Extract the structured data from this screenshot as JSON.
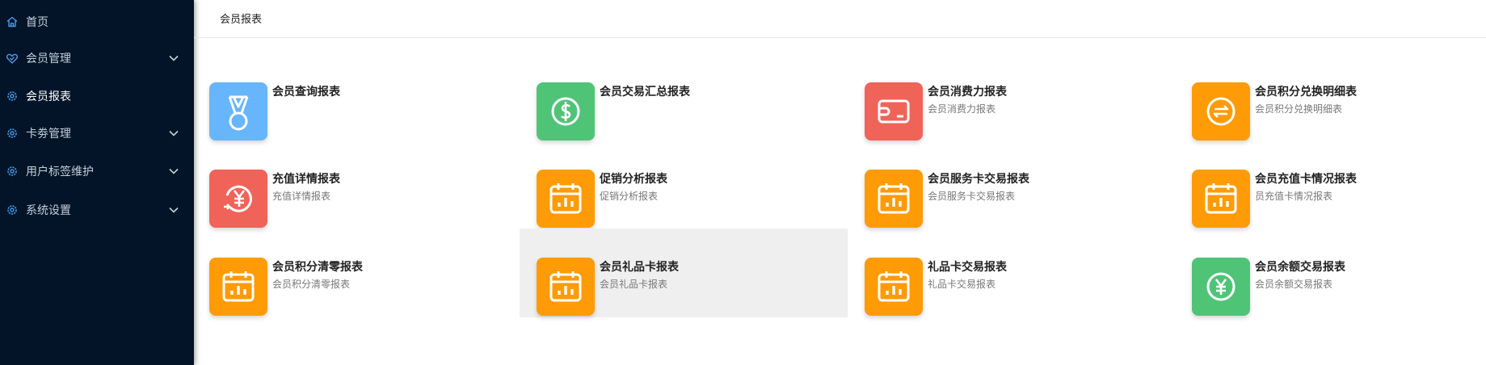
{
  "sidebar": {
    "items": [
      {
        "label": "首页",
        "icon": "home-icon",
        "expandable": false,
        "active": false
      },
      {
        "label": "会员管理",
        "icon": "heart-shield-icon",
        "expandable": true,
        "active": false
      },
      {
        "label": "会员报表",
        "icon": "gear-icon",
        "expandable": false,
        "active": true
      },
      {
        "label": "卡劵管理",
        "icon": "gear-icon",
        "expandable": true,
        "active": false
      },
      {
        "label": "用户标签维护",
        "icon": "gear-icon",
        "expandable": true,
        "active": false
      },
      {
        "label": "系统设置",
        "icon": "gear-icon",
        "expandable": true,
        "active": false
      }
    ]
  },
  "header": {
    "tab_label": "会员报表"
  },
  "colors": {
    "sidebar_bg": "#031428",
    "blue": "#67b5fb",
    "green": "#4fc477",
    "red": "#f06359",
    "orange": "#ff9b06"
  },
  "reports": [
    {
      "title": "会员查询报表",
      "subtitle": "",
      "icon": "medal-icon",
      "color": "blue"
    },
    {
      "title": "会员交易汇总报表",
      "subtitle": "",
      "icon": "dollar-icon",
      "color": "green"
    },
    {
      "title": "会员消费力报表",
      "subtitle": "会员消费力报表",
      "icon": "wallet-icon",
      "color": "red"
    },
    {
      "title": "会员积分兑换明细表",
      "subtitle": "会员积分兑换明细表",
      "icon": "exchange-icon",
      "color": "orange"
    },
    {
      "title": "充值详情报表",
      "subtitle": "充值详情报表",
      "icon": "yuan-refresh-icon",
      "color": "red"
    },
    {
      "title": "促销分析报表",
      "subtitle": "促销分析报表",
      "icon": "calendar-chart-icon",
      "color": "orange"
    },
    {
      "title": "会员服务卡交易报表",
      "subtitle": "会员服务卡交易报表",
      "icon": "calendar-chart-icon",
      "color": "orange"
    },
    {
      "title": "会员充值卡情况报表",
      "subtitle": "员充值卡情况报表",
      "icon": "calendar-chart-icon",
      "color": "orange"
    },
    {
      "title": "会员积分清零报表",
      "subtitle": "会员积分清零报表",
      "icon": "calendar-chart-icon",
      "color": "orange"
    },
    {
      "title": "会员礼品卡报表",
      "subtitle": "会员礼品卡报表",
      "icon": "calendar-chart-icon",
      "color": "orange",
      "hovered": true
    },
    {
      "title": "礼品卡交易报表",
      "subtitle": "礼品卡交易报表",
      "icon": "calendar-chart-icon",
      "color": "orange"
    },
    {
      "title": "会员余额交易报表",
      "subtitle": "会员余额交易报表",
      "icon": "yuan-circle-icon",
      "color": "green"
    }
  ]
}
